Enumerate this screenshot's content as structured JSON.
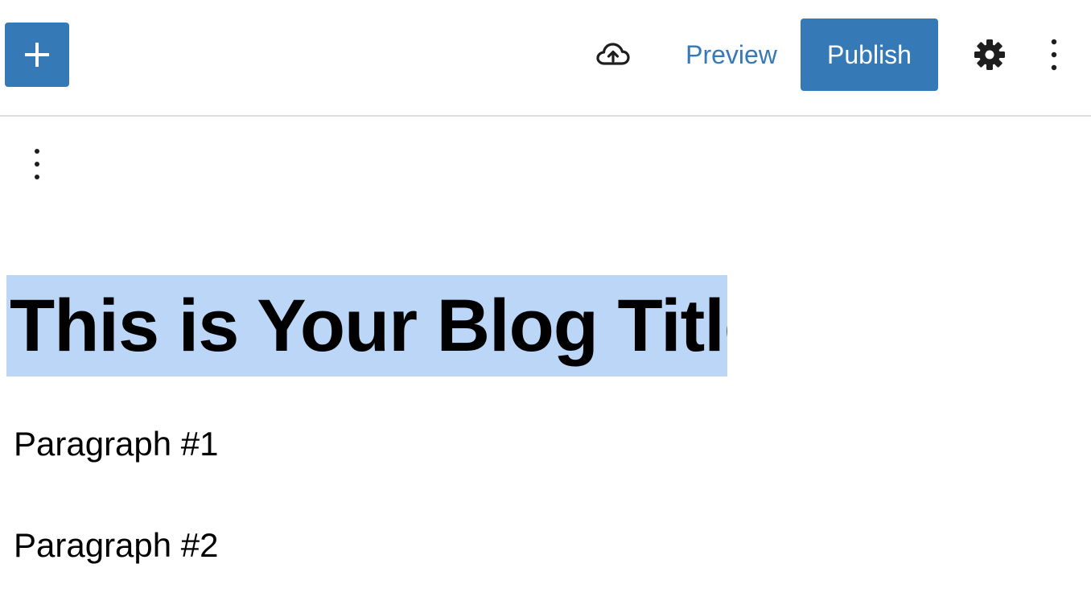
{
  "toolbar": {
    "add_block_icon": "plus-icon",
    "save_draft_icon": "cloud-upload-icon",
    "preview_label": "Preview",
    "publish_label": "Publish",
    "settings_icon": "gear-icon",
    "options_icon": "vertical-ellipsis-icon"
  },
  "block_toolbar": {
    "options_icon": "vertical-ellipsis-icon"
  },
  "content": {
    "title": "This is Your Blog Title",
    "paragraphs": [
      "Paragraph #1",
      "Paragraph #2"
    ]
  },
  "colors": {
    "accent": "#3579b7",
    "selection": "#bcd6f7",
    "divider": "#dddddd"
  }
}
